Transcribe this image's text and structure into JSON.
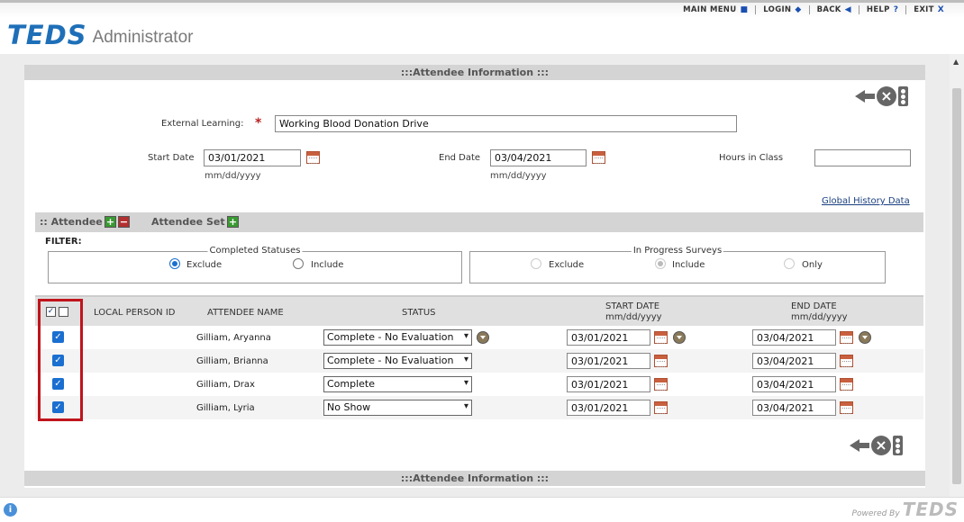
{
  "nav": {
    "links": [
      {
        "label": "MAIN MENU",
        "icon": "square-icon"
      },
      {
        "label": "LOGIN",
        "icon": "diamond-icon"
      },
      {
        "label": "BACK",
        "icon": "back-arrow-icon"
      },
      {
        "label": "HELP",
        "icon": "question-icon"
      },
      {
        "label": "EXIT",
        "icon": "x-icon"
      }
    ]
  },
  "header": {
    "logo": "TEDS",
    "subtitle": "Administrator"
  },
  "section": {
    "top_title": ":::Attendee Information :::",
    "bottom_title": ":::Attendee Information :::"
  },
  "form": {
    "external_learning_label": "External Learning:",
    "external_learning_required": "*",
    "external_learning_value": "Working Blood Donation Drive",
    "start_date_label": "Start Date",
    "start_date_value": "03/01/2021",
    "start_date_hint": "mm/dd/yyyy",
    "end_date_label": "End Date",
    "end_date_value": "03/04/2021",
    "end_date_hint": "mm/dd/yyyy",
    "hours_label": "Hours in Class",
    "hours_value": "",
    "global_history_link": "Global History Data"
  },
  "attendee_bar": {
    "attendee_label": ":: Attendee",
    "attendee_set_label": "Attendee Set"
  },
  "filter": {
    "label": "FILTER:",
    "completed": {
      "legend": "Completed Statuses",
      "options": [
        "Exclude",
        "Include"
      ],
      "selected": "Exclude"
    },
    "in_progress": {
      "legend": "In Progress Surveys",
      "options": [
        "Exclude",
        "Include",
        "Only"
      ],
      "selected": "Include"
    }
  },
  "table": {
    "headers": {
      "local_person_id": "LOCAL PERSON ID",
      "attendee_name": "ATTENDEE NAME",
      "status": "STATUS",
      "start_date": "START DATE",
      "start_date_fmt": "mm/dd/yyyy",
      "end_date": "END DATE",
      "end_date_fmt": "mm/dd/yyyy"
    },
    "rows": [
      {
        "name": "Gilliam, Aryanna",
        "status": "Complete - No Evaluation",
        "start": "03/01/2021",
        "end": "03/04/2021"
      },
      {
        "name": "Gilliam, Brianna",
        "status": "Complete - No Evaluation",
        "start": "03/01/2021",
        "end": "03/04/2021"
      },
      {
        "name": "Gilliam, Drax",
        "status": "Complete",
        "start": "03/01/2021",
        "end": "03/04/2021"
      },
      {
        "name": "Gilliam, Lyria",
        "status": "No Show",
        "start": "03/01/2021",
        "end": "03/04/2021"
      }
    ]
  },
  "footer": {
    "powered_by": "Powered By",
    "logo": "TEDS"
  },
  "colors": {
    "brand": "#1e6fb8",
    "highlight": "#c0141c",
    "checkbox": "#1a6fd0"
  }
}
